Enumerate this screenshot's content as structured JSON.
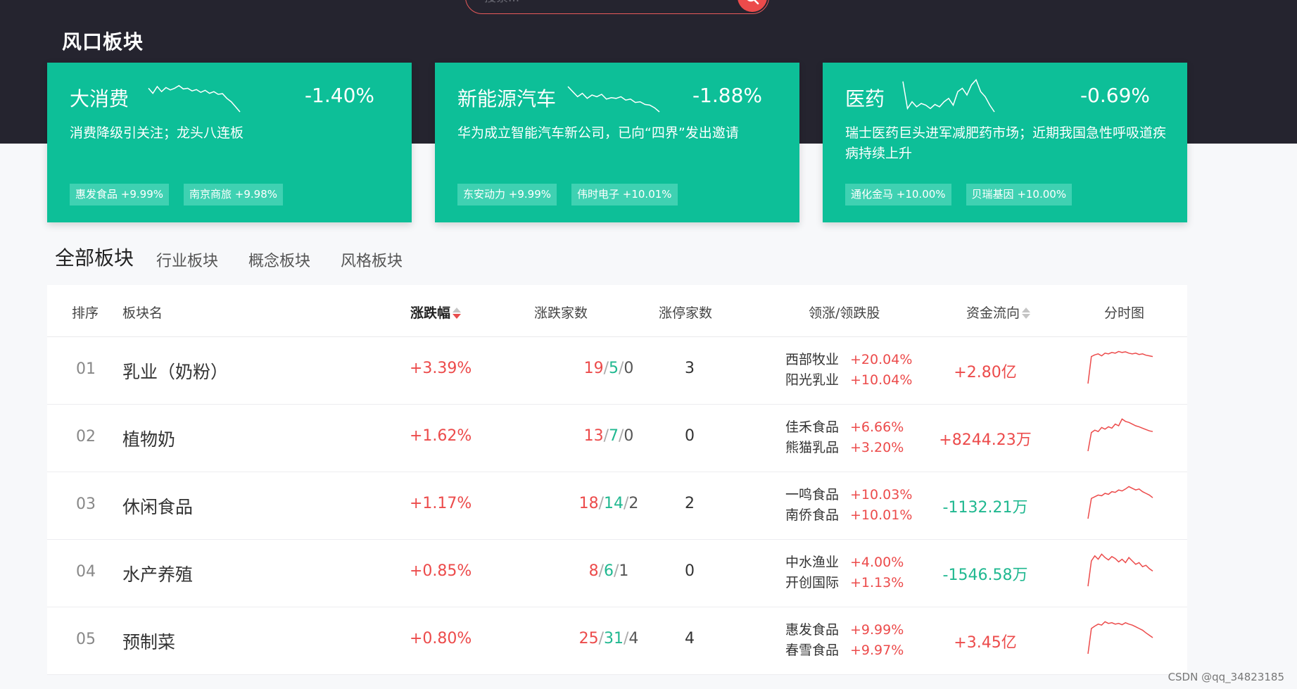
{
  "search": {
    "placeholder": "搜索..."
  },
  "section_title": "风口板块",
  "hot_cards": [
    {
      "name": "大消费",
      "change": "-1.40%",
      "desc": "消费降级引关注；龙头八连板",
      "tags": [
        "惠发食品 +9.99%",
        "南京商旅 +9.98%"
      ],
      "spark": [
        0.3,
        0.45,
        0.25,
        0.4,
        0.28,
        0.35,
        0.3,
        0.22,
        0.32,
        0.3,
        0.38,
        0.34,
        0.42,
        0.36,
        0.45,
        0.4,
        0.48,
        0.46,
        0.6,
        0.7,
        0.85,
        1.0
      ]
    },
    {
      "name": "新能源汽车",
      "change": "-1.88%",
      "desc": "华为成立智能汽车新公司，已向“四界”发出邀请",
      "tags": [
        "东安动力 +9.99%",
        "伟时电子 +10.01%"
      ],
      "spark": [
        0.25,
        0.4,
        0.55,
        0.45,
        0.6,
        0.5,
        0.55,
        0.48,
        0.62,
        0.58,
        0.6,
        0.55,
        0.65,
        0.62,
        0.72,
        0.7,
        0.78,
        0.8,
        0.88,
        1.0
      ]
    },
    {
      "name": "医药",
      "change": "-0.69%",
      "desc": "瑞士医药巨头进军减肥药市场；近期我国急性呼吸道疾病持续上升",
      "tags": [
        "通化金马 +10.00%",
        "贝瑞基因 +10.00%"
      ],
      "spark": [
        0.1,
        0.9,
        0.7,
        0.85,
        0.75,
        0.8,
        0.9,
        0.78,
        0.85,
        0.7,
        0.6,
        0.8,
        0.4,
        0.3,
        0.5,
        0.2,
        0.05,
        0.4,
        0.55,
        0.8,
        1.0
      ]
    }
  ],
  "tabs": [
    "全部板块",
    "行业板块",
    "概念板块",
    "风格板块"
  ],
  "table": {
    "headers": {
      "rank": "排序",
      "name": "板块名",
      "change": "涨跌幅",
      "counts": "涨跌家数",
      "limit_up": "涨停家数",
      "leaders": "领涨/领跌股",
      "flow": "资金流向",
      "chart": "分时图"
    },
    "rows": [
      {
        "rank": "01",
        "name": "乳业（奶粉）",
        "change": "+3.39%",
        "up": "19",
        "down": "5",
        "flat": "0",
        "limit_up": "3",
        "leaders": [
          {
            "name": "西部牧业",
            "chg": "+20.04%"
          },
          {
            "name": "阳光乳业",
            "chg": "+10.04%"
          }
        ],
        "flow": "+2.80亿",
        "flow_dir": "pos",
        "mini": [
          1.0,
          0.2,
          0.15,
          0.12,
          0.18,
          0.1,
          0.12,
          0.08,
          0.1,
          0.05,
          0.08,
          0.06,
          0.1,
          0.12,
          0.1,
          0.14,
          0.12,
          0.16,
          0.18,
          0.2
        ]
      },
      {
        "rank": "02",
        "name": "植物奶",
        "change": "+1.62%",
        "up": "13",
        "down": "7",
        "flat": "0",
        "limit_up": "0",
        "leaders": [
          {
            "name": "佳禾食品",
            "chg": "+6.66%"
          },
          {
            "name": "熊猫乳品",
            "chg": "+3.20%"
          }
        ],
        "flow": "+8244.23万",
        "flow_dir": "pos",
        "mini": [
          1.0,
          0.45,
          0.38,
          0.42,
          0.3,
          0.35,
          0.28,
          0.32,
          0.2,
          0.25,
          0.05,
          0.12,
          0.15,
          0.2,
          0.25,
          0.28,
          0.32,
          0.36,
          0.4,
          0.42
        ]
      },
      {
        "rank": "03",
        "name": "休闲食品",
        "change": "+1.17%",
        "up": "18",
        "down": "14",
        "flat": "2",
        "limit_up": "2",
        "leaders": [
          {
            "name": "一鸣食品",
            "chg": "+10.03%"
          },
          {
            "name": "南侨食品",
            "chg": "+10.01%"
          }
        ],
        "flow": "-1132.21万",
        "flow_dir": "neg",
        "mini": [
          1.0,
          0.4,
          0.35,
          0.3,
          0.32,
          0.25,
          0.28,
          0.2,
          0.22,
          0.15,
          0.18,
          0.12,
          0.05,
          0.1,
          0.15,
          0.12,
          0.2,
          0.25,
          0.3,
          0.38
        ]
      },
      {
        "rank": "04",
        "name": "水产养殖",
        "change": "+0.85%",
        "up": "8",
        "down": "6",
        "flat": "1",
        "limit_up": "0",
        "leaders": [
          {
            "name": "中水渔业",
            "chg": "+4.00%"
          },
          {
            "name": "开创国际",
            "chg": "+1.13%"
          }
        ],
        "flow": "-1546.58万",
        "flow_dir": "neg",
        "mini": [
          1.0,
          0.25,
          0.1,
          0.2,
          0.05,
          0.15,
          0.22,
          0.12,
          0.18,
          0.28,
          0.2,
          0.3,
          0.15,
          0.25,
          0.35,
          0.3,
          0.42,
          0.38,
          0.48,
          0.55
        ]
      },
      {
        "rank": "05",
        "name": "预制菜",
        "change": "+0.80%",
        "up": "25",
        "down": "31",
        "flat": "4",
        "limit_up": "4",
        "leaders": [
          {
            "name": "惠发食品",
            "chg": "+9.99%"
          },
          {
            "name": "春雪食品",
            "chg": "+9.97%"
          }
        ],
        "flow": "+3.45亿",
        "flow_dir": "pos",
        "mini": [
          1.0,
          0.25,
          0.18,
          0.12,
          0.15,
          0.05,
          0.1,
          0.08,
          0.12,
          0.1,
          0.14,
          0.08,
          0.12,
          0.15,
          0.2,
          0.25,
          0.3,
          0.38,
          0.45,
          0.52
        ]
      }
    ]
  },
  "watermark": "CSDN @qq_34823185",
  "colors": {
    "hero_bg": "#25242f",
    "card_bg": "#0dbf98",
    "up_red": "#ec4b4b",
    "down_green": "#20b890"
  }
}
